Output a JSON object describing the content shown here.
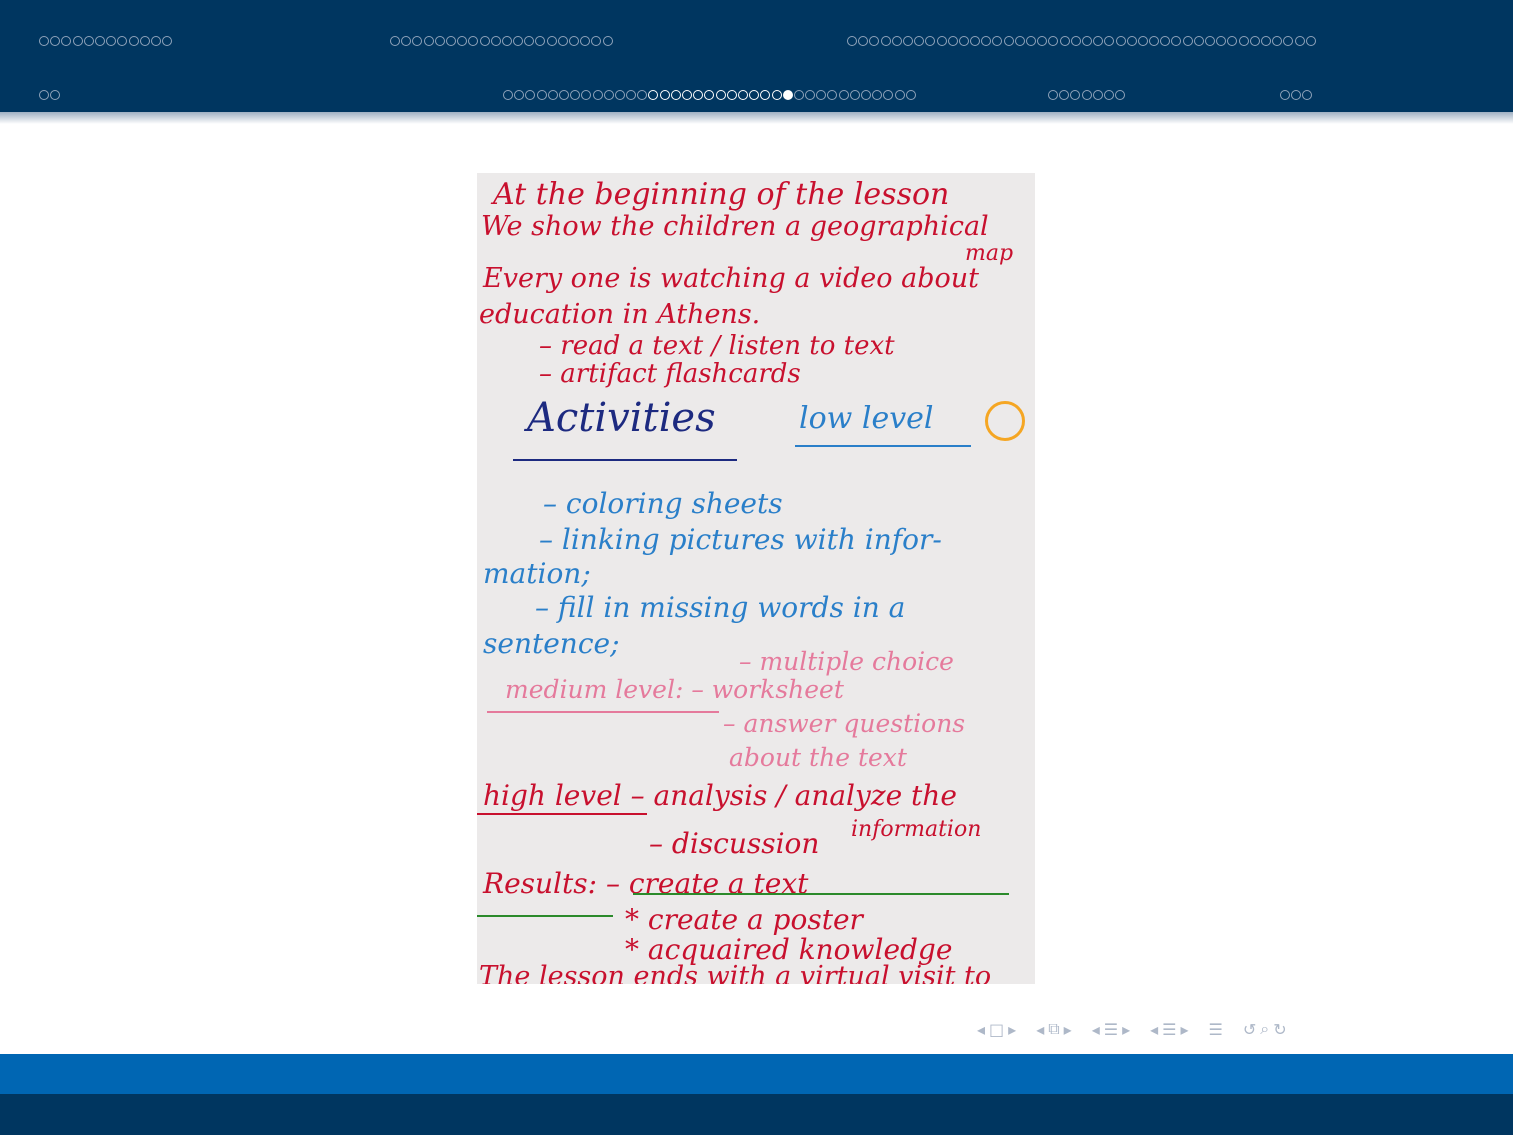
{
  "headline": {
    "row1": [
      {
        "count": 12,
        "lit": [],
        "current": -1
      },
      {
        "count": 20,
        "lit": [],
        "current": -1
      },
      {
        "count": 42,
        "lit": [],
        "current": -1
      }
    ],
    "row2": [
      {
        "count": 2,
        "lit": [],
        "current": -1
      },
      {
        "count": 37,
        "lit": [
          13,
          14,
          15,
          16,
          15,
          17,
          18,
          19,
          20,
          21,
          22,
          23,
          24,
          25
        ],
        "current": 25
      },
      {
        "count": 7,
        "lit": [],
        "current": -1
      },
      {
        "count": 3,
        "lit": [],
        "current": -1
      }
    ]
  },
  "poster": {
    "lines": [
      "At the beginning of the lesson",
      "We show the children a geographical",
      "map",
      "Every one is watching a video about",
      "education in Athens.",
      "– read a text / listen to text",
      "– artifact flashcards",
      "Activities",
      "low level",
      "– coloring sheets",
      "– linking pictures with infor-",
      "mation;",
      "– fill in missing words in a",
      "sentence;",
      "– multiple choice",
      "medium level: – worksheet",
      "– answer questions",
      "about the text",
      "high level – analysis / analyze the",
      "information",
      "– discussion",
      "Results: – create a text",
      "* create a poster",
      "* acquaired knowledge",
      "The lesson ends with a virtual visit to"
    ]
  },
  "navigation": {
    "icons": [
      "frame-prev-icon",
      "frame-icon",
      "frame-next-icon",
      "subsection-prev-icon",
      "subsection-icon",
      "subsection-next-icon",
      "section-prev-icon",
      "section-icon",
      "section-next-icon",
      "doc-prev-icon",
      "doc-icon",
      "doc-next-icon",
      "toc-icon",
      "back-icon",
      "search-icon",
      "forward-icon"
    ],
    "glyphs": [
      "◂",
      "□",
      "▸",
      "◂",
      "⧉",
      "▸",
      "◂",
      "☰",
      "▸",
      "◂",
      "☰",
      "▸",
      "☰",
      "↺",
      "⌕",
      "↻"
    ]
  }
}
